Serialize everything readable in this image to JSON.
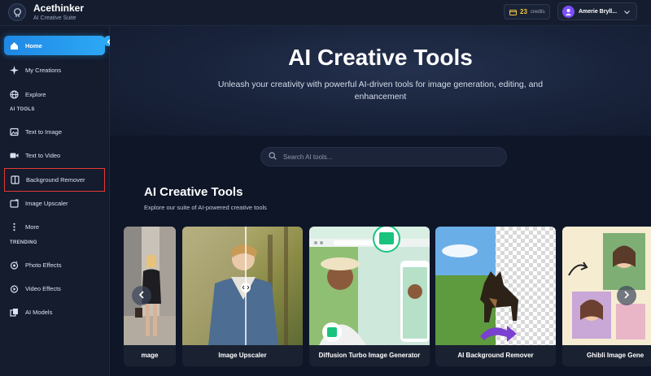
{
  "brand": {
    "name": "Acethinker",
    "subtitle": "AI Creative Suite",
    "logo_icon": "brain-icon"
  },
  "credits": {
    "count": "23",
    "label": "credits",
    "icon": "coin-icon",
    "color": "#f4c542"
  },
  "user": {
    "name": "Amerie Bryll...",
    "avatar_icon": "user-icon"
  },
  "sidebar": {
    "items": [
      {
        "label": "Home",
        "icon": "home-icon",
        "active": true
      },
      {
        "label": "My Creations",
        "icon": "sparkle-icon"
      },
      {
        "label": "Explore",
        "icon": "globe-icon"
      }
    ],
    "ai_tools_label": "AI TOOLS",
    "ai_tools": [
      {
        "label": "Text to Image",
        "icon": "image-edit-icon"
      },
      {
        "label": "Text to Video",
        "icon": "video-icon"
      },
      {
        "label": "Background Remover",
        "icon": "layers-icon",
        "highlighted": true
      },
      {
        "label": "Image Upscaler",
        "icon": "upscale-icon"
      },
      {
        "label": "More",
        "icon": "more-vertical-icon"
      }
    ],
    "trending_label": "TRENDING",
    "trending": [
      {
        "label": "Photo Effects",
        "icon": "photo-effect-icon"
      },
      {
        "label": "Video Effects",
        "icon": "video-effect-icon"
      },
      {
        "label": "AI Models",
        "icon": "models-icon"
      }
    ]
  },
  "hero": {
    "title": "AI Creative Tools",
    "subtitle": "Unleash your creativity with powerful AI-driven tools for image generation, editing, and enhancement"
  },
  "search": {
    "placeholder": "Search AI tools..."
  },
  "tools_section": {
    "title": "AI Creative Tools",
    "subtitle": "Explore our suite of AI-powered creative tools",
    "cards": [
      {
        "label": "mage"
      },
      {
        "label": "Image Upscaler"
      },
      {
        "label": "Diffusion Turbo Image Generator"
      },
      {
        "label": "AI Background Remover"
      },
      {
        "label": "Ghibli Image Gene"
      }
    ]
  },
  "colors": {
    "accent": "#2da8f5",
    "highlight_border": "#e53935",
    "background": "#0e1628"
  }
}
